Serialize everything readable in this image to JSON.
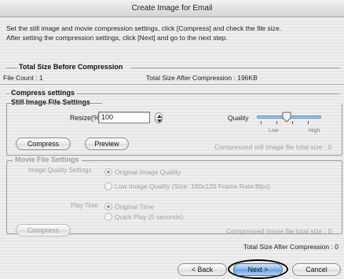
{
  "window": {
    "title": "Create Image for Email"
  },
  "instructions": {
    "line1": "Set the still image and movie compression settings, click [Compress] and check the file size.",
    "line2": "After setting the compression settings, click [Next] and go to the next step."
  },
  "before": {
    "title": "Total Size Before Compression",
    "file_count": "File Count : 1",
    "total_after": "Total Size After Compression : 196KB"
  },
  "compress_settings": {
    "title": "Compress settings"
  },
  "still": {
    "title": "Still Image File Settings",
    "resize_label": "Resize(%)",
    "resize_value": "100",
    "quality_label": "Quality",
    "quality_low": "Low",
    "quality_high": "High",
    "quality_level": 0.4,
    "compress_button": "Compress",
    "preview_button": "Preview",
    "total_size": "Compressed still image file total size : 0"
  },
  "movie": {
    "title": "Movie File Settings",
    "image_quality_label": "Image Quality Settings",
    "opt_original_quality": "Original Image Quality",
    "opt_low_quality": "Low Image Quality (Size: 160x120 Frame Rate:8fps)",
    "play_time_label": "Play Time",
    "opt_original_time": "Original Time",
    "opt_quick_play": "Quick Play (5 seconds)",
    "compress_button": "Compress",
    "total_size": "Compressed movie file total size : 0"
  },
  "footer": {
    "total_after": "Total Size After Compression : 0",
    "back_button": "< Back",
    "next_button": "Next >",
    "cancel_button": "Cancel"
  }
}
